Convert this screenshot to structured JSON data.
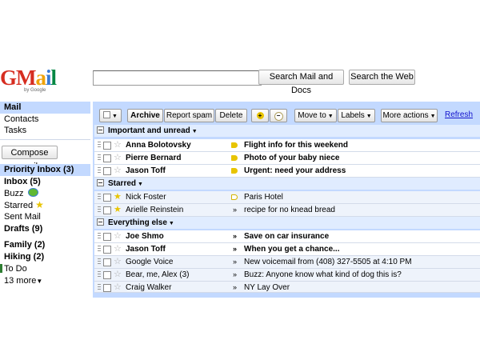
{
  "logo": {
    "word": "GMail",
    "sub": "by Google"
  },
  "search": {
    "value": "",
    "mail_button": "Search Mail and Docs",
    "web_button": "Search the Web"
  },
  "sidebar": {
    "top": [
      "Mail",
      "Contacts",
      "Tasks"
    ],
    "compose": "Compose mail",
    "labels": [
      "Priority Inbox (3)",
      "Inbox (5)",
      "Buzz",
      "Starred",
      "Sent Mail",
      "Drafts (9)",
      "Family (2)",
      "Hiking (2)",
      "To Do",
      "13 more"
    ]
  },
  "toolbar": {
    "archive": "Archive",
    "report_spam": "Report spam",
    "delete": "Delete",
    "move_to": "Move to",
    "labels": "Labels",
    "more_actions": "More actions",
    "refresh": "Refresh"
  },
  "sections": [
    "Important and unread",
    "Starred",
    "Everything else"
  ],
  "emails": [
    {
      "sender": "Anna Bolotovsky",
      "subject": "Flight info for this weekend"
    },
    {
      "sender": "Pierre Bernard",
      "subject": "Photo of your baby niece"
    },
    {
      "sender": "Jason Toff",
      "subject": "Urgent: need your address"
    },
    {
      "sender": "Nick Foster",
      "subject": "Paris Hotel"
    },
    {
      "sender": "Arielle Reinstein",
      "subject": "recipe for no knead bread"
    },
    {
      "sender": "Joe Shmo",
      "subject": "Save on car insurance"
    },
    {
      "sender": "Jason Toff",
      "subject": "When you get a chance..."
    },
    {
      "sender": "Google Voice",
      "subject": "New voicemail from (408) 327-5505 at 4:10 PM"
    },
    {
      "sender": "Bear, me, Alex (3)",
      "subject": "Buzz: Anyone know what kind of dog this is?"
    },
    {
      "sender": "Craig Walker",
      "subject": "NY Lay Over"
    }
  ],
  "colors": {
    "accent": "#c3d9ff",
    "section": "#e0ecff",
    "link": "#1111cc",
    "important": "#e8c400"
  }
}
